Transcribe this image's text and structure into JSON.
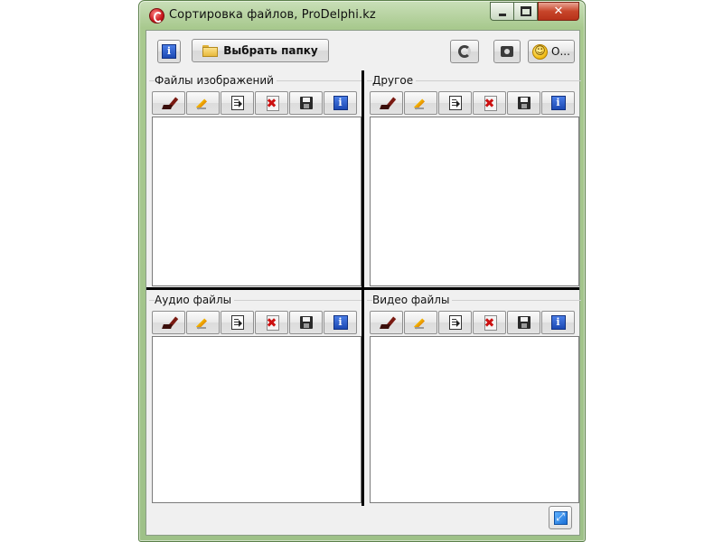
{
  "window": {
    "title": "Сортировка файлов, ProDelphi.kz",
    "close_symbol": "✕"
  },
  "toolbar": {
    "info_label": "i",
    "choose_folder_label": "Выбрать папку",
    "about_label": "О..."
  },
  "panels": [
    {
      "title": "Файлы изображений"
    },
    {
      "title": "Другое"
    },
    {
      "title": "Аудио файлы"
    },
    {
      "title": "Видео файлы"
    }
  ],
  "panel_toolbar": {
    "info_label": "i"
  }
}
